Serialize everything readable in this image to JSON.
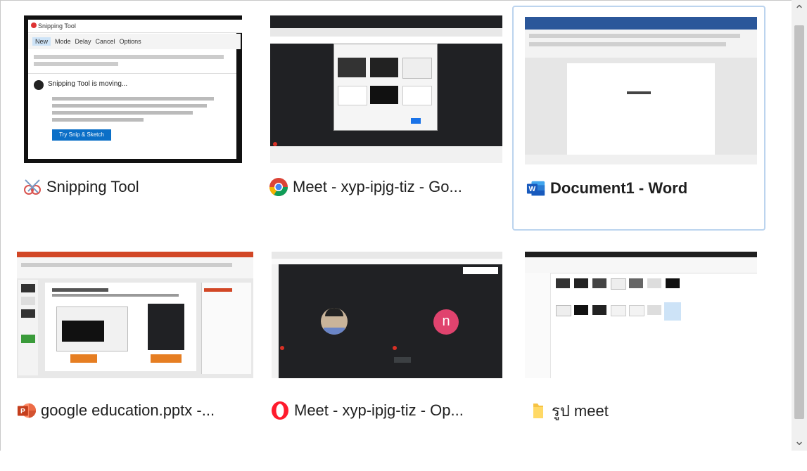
{
  "windows": [
    {
      "title": "Snipping Tool",
      "icon": "snipping-tool-icon",
      "selected": false,
      "bold": false
    },
    {
      "title": "Meet - xyp-ipjg-tiz - Go...",
      "icon": "chrome-icon",
      "selected": false,
      "bold": false
    },
    {
      "title": "Document1 - Word",
      "icon": "word-icon",
      "selected": true,
      "bold": true
    },
    {
      "title": "google education.pptx -...",
      "icon": "powerpoint-icon",
      "selected": false,
      "bold": false
    },
    {
      "title": "Meet - xyp-ipjg-tiz - Op...",
      "icon": "opera-icon",
      "selected": false,
      "bold": false
    },
    {
      "title": "รูป meet",
      "icon": "folder-icon",
      "selected": false,
      "bold": false
    }
  ],
  "snipping": {
    "title": "Snipping Tool",
    "toolbar": [
      "New",
      "Mode",
      "Delay",
      "Cancel",
      "Options"
    ],
    "moving_title": "Snipping Tool is moving...",
    "button": "Try Snip & Sketch"
  },
  "meet_opera": {
    "avatar_letter": "n"
  },
  "colors": {
    "selected_border": "#bcd4ee",
    "word_blue": "#2b579a",
    "ppt_orange": "#d24726",
    "meet_dark": "#202124"
  }
}
